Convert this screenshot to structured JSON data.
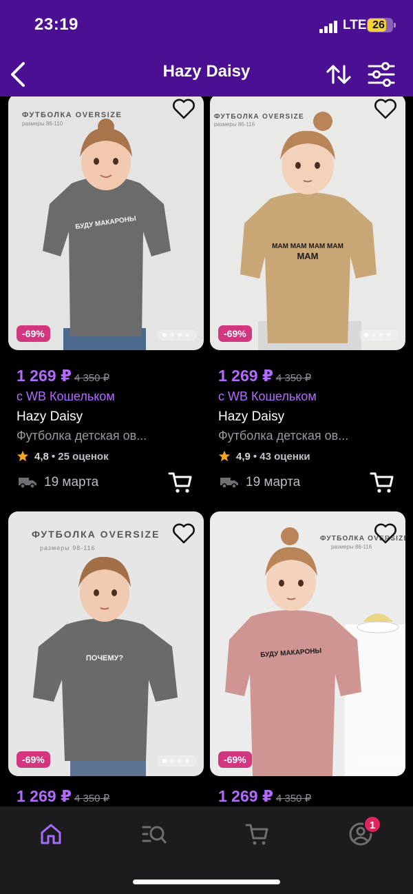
{
  "status_bar": {
    "time": "23:19",
    "network": "LTE",
    "battery": "26"
  },
  "header": {
    "title": "Hazy Daisy",
    "back_icon": "chevron-left-icon",
    "sort_icon": "sort-arrows-icon",
    "filter_icon": "sliders-icon"
  },
  "colors": {
    "header_bg": "#4b0f93",
    "price": "#b36bff",
    "discount_badge": "#d1367f",
    "tab_active": "#a56cff",
    "notification": "#e0245e"
  },
  "products": [
    {
      "discount": "-69%",
      "price": "1 269 ₽",
      "old_price": "4 350 ₽",
      "wallet": "с WB Кошельком",
      "brand": "Hazy Daisy",
      "title": "Футболка детская ов...",
      "rating": "4,8",
      "reviews": "25 оценок",
      "delivery": "19 марта",
      "photo_caption": "ФУТБОЛКА OVERSIZE",
      "photo_sizes": "размеры 86-110",
      "shirt_text": "БУДУ МАКАРОНЫ",
      "shirt_color": "#6b6b6b",
      "bg_color": "#e4e4e4"
    },
    {
      "discount": "-69%",
      "price": "1 269 ₽",
      "old_price": "4 350 ₽",
      "wallet": "с WB Кошельком",
      "brand": "Hazy Daisy",
      "title": "Футболка детская ов...",
      "rating": "4,9",
      "reviews": "43 оценки",
      "delivery": "19 марта",
      "photo_caption": "ФУТБОЛКА OVERSIZE",
      "photo_sizes": "размеры 86-116",
      "shirt_text": "МАМ МАМ МАМ МАМ",
      "shirt_text2": "МАМ",
      "shirt_color": "#c9a675",
      "bg_color": "#e9e9e7"
    },
    {
      "discount": "-69%",
      "price": "1 269 ₽",
      "old_price": "4 350 ₽",
      "photo_caption": "ФУТБОЛКА OVERSIZE",
      "photo_sizes": "размеры 98-116",
      "shirt_text": "ПОЧЕМУ?",
      "shirt_color": "#6a6a6a",
      "bg_color": "#e6e6e6"
    },
    {
      "discount": "-69%",
      "price": "1 269 ₽",
      "old_price": "4 350 ₽",
      "photo_caption": "ФУТБОЛКА OVERSIZE",
      "photo_sizes": "размеры 86-116",
      "shirt_text": "БУДУ МАКАРОНЫ",
      "shirt_color": "#cf9592",
      "bg_color": "#ececec"
    }
  ],
  "tabbar": {
    "items": [
      "home-icon",
      "catalog-search-icon",
      "cart-icon",
      "profile-icon"
    ],
    "active": "home-icon",
    "profile_badge": "1"
  }
}
